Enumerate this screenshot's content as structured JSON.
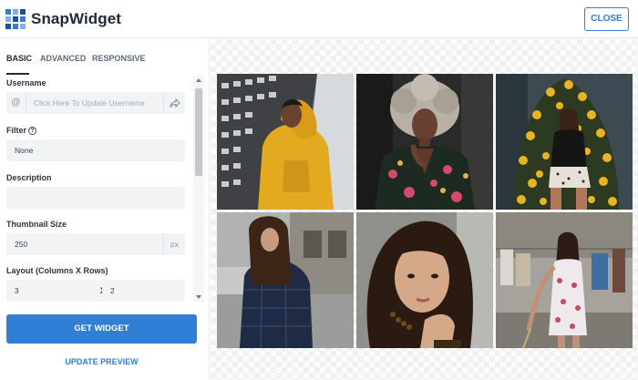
{
  "header": {
    "brand": "SnapWidget",
    "close_label": "CLOSE"
  },
  "tabs": [
    {
      "label": "BASIC",
      "active": true
    },
    {
      "label": "ADVANCED",
      "active": false
    },
    {
      "label": "RESPONSIVE",
      "active": false
    }
  ],
  "form": {
    "username": {
      "label": "Username",
      "prefix": "@",
      "placeholder": "Click Here To Update Username",
      "icon": "share-icon"
    },
    "filter": {
      "label": "Filter",
      "help_icon": "?",
      "value": "None"
    },
    "description": {
      "label": "Description",
      "value": ""
    },
    "thumbnail": {
      "label": "Thumbnail Size",
      "value": "250",
      "unit": "px"
    },
    "layout": {
      "label": "Layout (Columns X Rows)",
      "columns": "3",
      "separator": "X",
      "rows": "2"
    }
  },
  "actions": {
    "get_widget": "GET WIDGET",
    "update_preview": "UPDATE PREVIEW"
  },
  "colors": {
    "accent": "#2f7fd6",
    "field_bg": "#f1f3f5"
  },
  "preview": {
    "photos": [
      {
        "name": "photo-man-yellow-hoodie"
      },
      {
        "name": "photo-woman-curly-hair"
      },
      {
        "name": "photo-woman-sunflowers"
      },
      {
        "name": "photo-woman-plaid-coat"
      },
      {
        "name": "photo-woman-closeup"
      },
      {
        "name": "photo-woman-floral-dress"
      }
    ]
  }
}
